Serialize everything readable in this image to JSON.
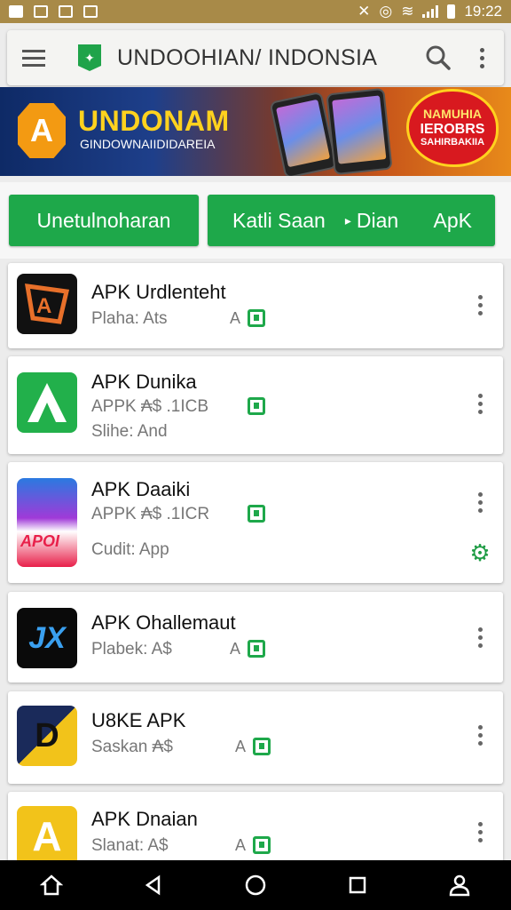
{
  "status_bar": {
    "time": "19:22"
  },
  "app_bar": {
    "title": "UNDOOHIAN/ INDONSIA"
  },
  "banner": {
    "logo_letter": "A",
    "title": "UNDONAM",
    "subtitle": "GINDOWNAIIDIDAREIA",
    "badge_line1": "NAMUHIA",
    "badge_line2": "IEROBRS",
    "badge_line3": "SAHIRBAKIIA"
  },
  "tabs": {
    "tab1": "Unetulnoharan",
    "tab2_a": "Katli Saan",
    "tab2_arrow": "▸",
    "tab2_b": "Dian",
    "tab2_c": "ApK"
  },
  "apps": [
    {
      "name": "APK Urdlenteht",
      "meta": "Plaha: Ats",
      "size": "A"
    },
    {
      "name": "APK Dunika",
      "meta": "APPK  ₳$  .1ICB",
      "meta2": "Slihe: And"
    },
    {
      "name": "APK Daaiki",
      "meta": "APPK  ₳$  .1ICR",
      "meta2": "Cudit: App"
    },
    {
      "name": "APK Ohallemaut",
      "meta": "Plabek: A$",
      "size": "A"
    },
    {
      "name": "U8KE APK",
      "meta": "Saskan ₳$",
      "size": "A"
    },
    {
      "name": "APK Dnaian",
      "meta": "Slanat: A$",
      "size": "A"
    }
  ],
  "app_icons": {
    "icon1": "A",
    "icon2": "A",
    "icon3": "APOI",
    "icon4": "JX",
    "icon5": "D",
    "icon6": "A"
  },
  "colors": {
    "accent_green": "#1ea84a",
    "status_bar": "#a88a48",
    "navbar": "#000000"
  }
}
